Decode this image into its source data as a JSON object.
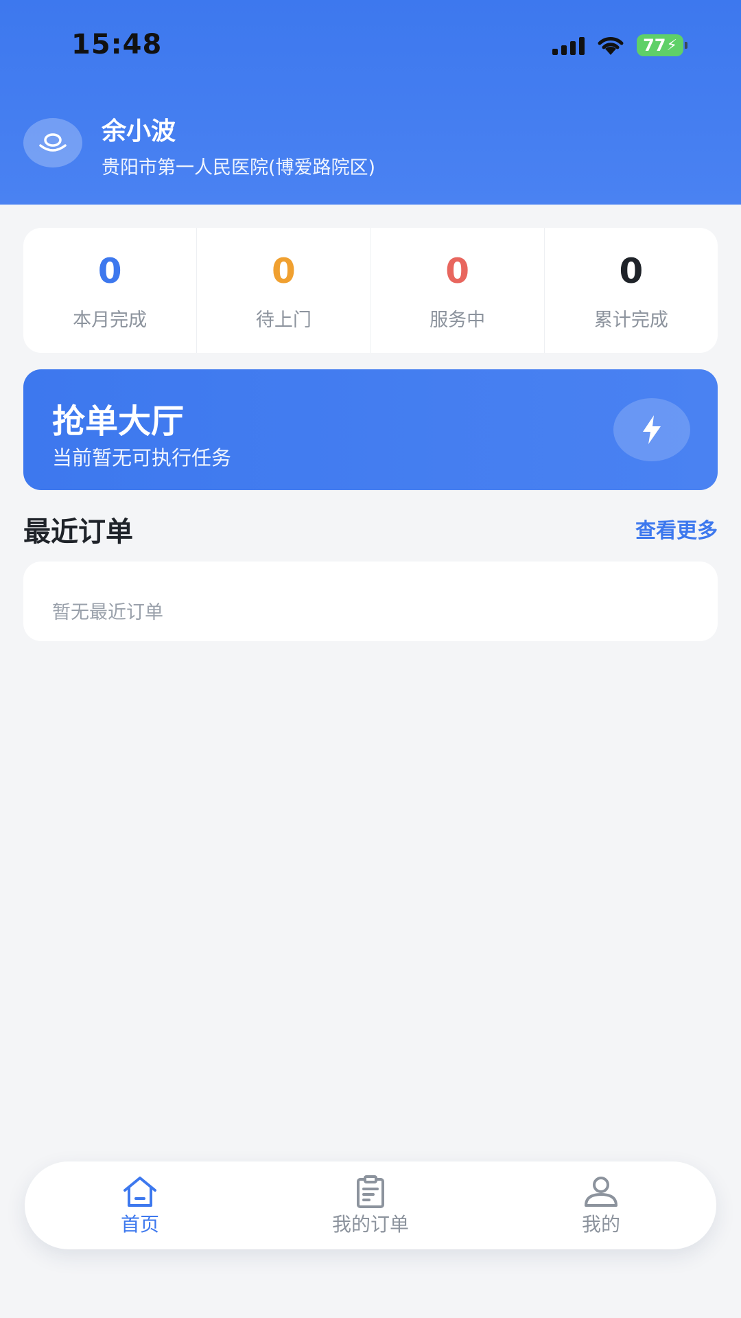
{
  "status_bar": {
    "time": "15:48",
    "battery": "77"
  },
  "user": {
    "name": "余小波",
    "organization": "贵阳市第一人民医院(博爱路院区)"
  },
  "stats": [
    {
      "value": "0",
      "label": "本月完成",
      "color": "#3d78ee"
    },
    {
      "value": "0",
      "label": "待上门",
      "color": "#f0a030"
    },
    {
      "value": "0",
      "label": "服务中",
      "color": "#e8665e"
    },
    {
      "value": "0",
      "label": "累计完成",
      "color": "#1f2329"
    }
  ],
  "banner": {
    "title": "抢单大厅",
    "subtitle": "当前暂无可执行任务",
    "icon": "lightning-icon"
  },
  "recent_orders": {
    "title": "最近订单",
    "more_label": "查看更多",
    "empty_text": "暂无最近订单"
  },
  "tabbar": {
    "items": [
      {
        "label": "首页",
        "icon": "home-icon",
        "active": true
      },
      {
        "label": "我的订单",
        "icon": "clipboard-icon",
        "active": false
      },
      {
        "label": "我的",
        "icon": "user-icon",
        "active": false
      }
    ]
  },
  "colors": {
    "accent": "#3d78ee",
    "background": "#f4f5f7",
    "inactive": "#8c939d"
  }
}
